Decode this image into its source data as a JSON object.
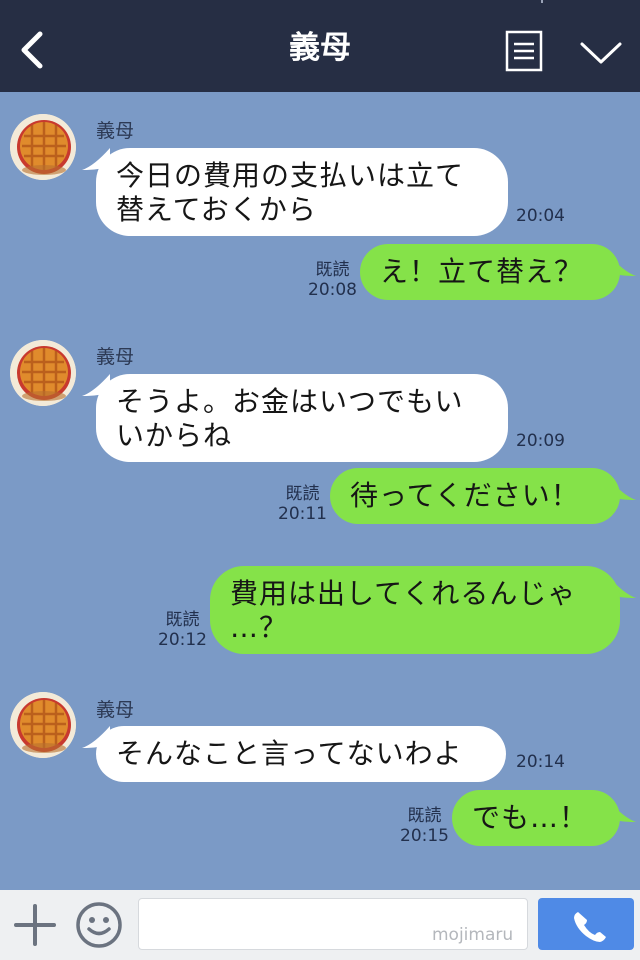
{
  "header": {
    "title": "義母",
    "icons": [
      "back-chevron-icon",
      "menu-list-icon",
      "chevron-down-icon"
    ]
  },
  "messages": [
    {
      "side": "in",
      "sender": "義母",
      "lines": [
        "今日の費用の支払いは立て",
        "替えておくから"
      ],
      "time": "20:04"
    },
    {
      "side": "out",
      "read": "既読",
      "text": "え！立て替え？",
      "time": "20:08"
    },
    {
      "side": "in",
      "sender": "義母",
      "lines": [
        "そうよ。お金はいつでもい",
        "いからね"
      ],
      "time": "20:09"
    },
    {
      "side": "out",
      "read": "既読",
      "text": "待ってください！",
      "time": "20:11"
    },
    {
      "side": "out",
      "read": "既読",
      "lines": [
        "費用は出してくれるんじゃ",
        "…？"
      ],
      "time": "20:12"
    },
    {
      "side": "in",
      "sender": "義母",
      "text": "そんなこと言ってないわよ",
      "time": "20:14"
    },
    {
      "side": "out",
      "read": "既読",
      "text": "でも…！",
      "time": "20:15"
    }
  ],
  "input": {
    "placeholder": "",
    "watermark": "mojimaru",
    "icons": [
      "plus-icon",
      "smile-icon",
      "phone-icon"
    ]
  },
  "colors": {
    "header_bg": "#262e44",
    "chat_bg": "#7b9ac6",
    "incoming_bubble": "#ffffff",
    "outgoing_bubble": "#85e249",
    "call_button": "#4f8ae6"
  }
}
